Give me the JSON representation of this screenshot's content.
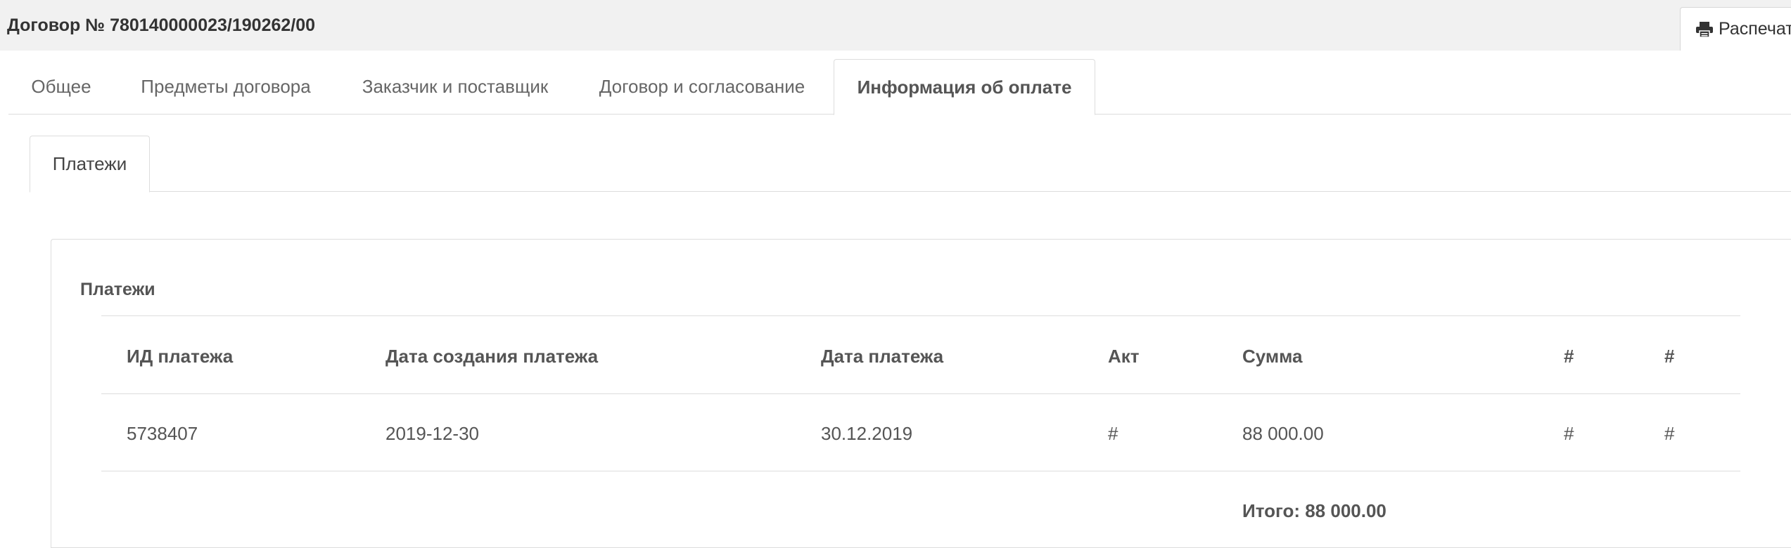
{
  "header": {
    "title": "Договор № 780140000023/190262/00",
    "print_label": "Распечатать"
  },
  "main_tabs": [
    {
      "label": "Общее",
      "active": false
    },
    {
      "label": "Предметы договора",
      "active": false
    },
    {
      "label": "Заказчик и поставщик",
      "active": false
    },
    {
      "label": "Договор и согласование",
      "active": false
    },
    {
      "label": "Информация об оплате",
      "active": true
    }
  ],
  "sub_tabs": [
    {
      "label": "Платежи",
      "active": true
    }
  ],
  "panel": {
    "title": "Платежи",
    "columns": [
      "ИД платежа",
      "Дата создания платежа",
      "Дата платежа",
      "Акт",
      "Сумма",
      "#",
      "#"
    ],
    "rows": [
      [
        "5738407",
        "2019-12-30",
        "30.12.2019",
        "#",
        "88 000.00",
        "#",
        "#"
      ]
    ],
    "total": "Итого: 88 000.00"
  },
  "colors": {
    "topbar": "#f1f1f1",
    "border": "#dddddd",
    "text": "#555555"
  },
  "icons": {
    "print": "printer-icon"
  }
}
